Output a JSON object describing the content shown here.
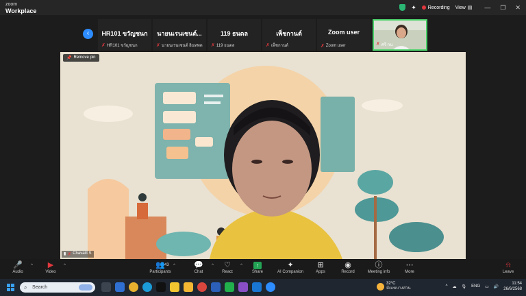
{
  "window": {
    "brand_top": "zoom",
    "brand_bottom": "Workplace",
    "recording_label": "Recording",
    "view_label": "View",
    "controls": [
      "—",
      "❐",
      "✕"
    ]
  },
  "participants": [
    {
      "display": "HR101 ขวัญชนก",
      "caption": "HR101 ขวัญชนก"
    },
    {
      "display": "นายนเรนเซนต์...",
      "caption": "นายนเรนเซนต์ อินทพต"
    },
    {
      "display": "119 ธนดล",
      "caption": "119 ธนดล"
    },
    {
      "display": "เพ็ชกานต์",
      "caption": "เพ็ชกานต์"
    },
    {
      "display": "Zoom user",
      "caption": "Zoom user"
    }
  ],
  "self_view": {
    "caption": "ศรี กน"
  },
  "main_video": {
    "pin_label": "Remove pin",
    "speaker_name": "Chavalit S"
  },
  "toolbar": {
    "audio": "Audio",
    "video": "Video",
    "participants": "Participants",
    "participants_count": "43",
    "chat": "Chat",
    "react": "React",
    "share": "Share",
    "ai_companion": "AI Companion",
    "apps": "Apps",
    "record": "Record",
    "meeting_info": "Meeting info",
    "more": "More",
    "leave": "Leave"
  },
  "taskbar": {
    "search_placeholder": "Search",
    "weather_temp": "32°C",
    "weather_desc": "มีเมฆบางส่วน",
    "lang": "ENG",
    "time": "11:54",
    "date": "26/6/2568"
  },
  "colors": {
    "accent": "#2d8cff",
    "recording": "#e0383e",
    "active_speaker": "#4cd36a",
    "share_green": "#23a455"
  }
}
